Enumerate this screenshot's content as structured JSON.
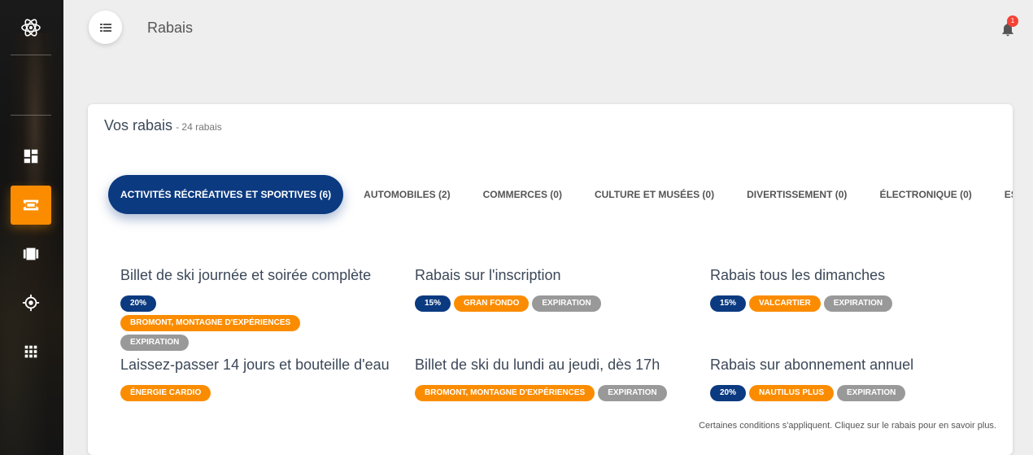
{
  "header": {
    "title": "Rabais",
    "notification_count": "1"
  },
  "sidebar": {
    "items": [
      {
        "icon": "dashboard-icon"
      },
      {
        "icon": "ticket-icon",
        "active": true
      },
      {
        "icon": "cards-icon"
      },
      {
        "icon": "target-icon"
      },
      {
        "icon": "apps-grid-icon"
      }
    ]
  },
  "card": {
    "title": "Vos rabais",
    "subtitle": "- 24 rabais",
    "tabs": [
      "Activités récréatives et sportives (6)",
      "Automobiles (2)",
      "Commerces (0)",
      "Culture et musées (0)",
      "Divertissement (0)",
      "Électronique (0)",
      "Escapad"
    ],
    "deals": [
      {
        "title": "Billet de ski journée et soirée complète",
        "badges": [
          "20%",
          "Bromont, montagne d'expériences",
          "Expiration"
        ]
      },
      {
        "title": "Rabais sur l'inscription",
        "badges": [
          "15%",
          "Gran Fondo",
          "Expiration"
        ]
      },
      {
        "title": "Rabais tous les dimanches",
        "badges": [
          "15%",
          "Valcartier",
          "Expiration"
        ]
      },
      {
        "title": "Laissez-passer 14 jours et bouteille d'eau",
        "badges": [
          "Énergie Cardio"
        ]
      },
      {
        "title": "Billet de ski du lundi au jeudi, dès 17h",
        "badges": [
          "Bromont, montagne d'expériences",
          "Expiration"
        ]
      },
      {
        "title": "Rabais sur abonnement annuel",
        "badges": [
          "20%",
          "Nautilus Plus",
          "Expiration"
        ]
      }
    ],
    "note": "Certaines conditions s'appliquent. Cliquez sur le rabais pour en savoir plus."
  },
  "colors": {
    "primary": "#0b3a80",
    "accent": "#fb8c00",
    "muted": "#999999",
    "alert": "#f44336"
  }
}
